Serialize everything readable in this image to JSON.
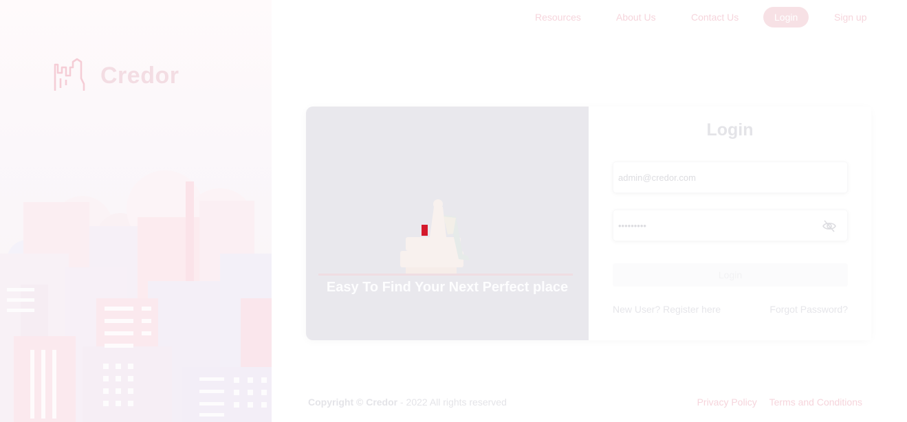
{
  "brand": {
    "name": "Credor"
  },
  "nav": {
    "items": [
      {
        "label": "Resources"
      },
      {
        "label": "About Us"
      },
      {
        "label": "Contact Us"
      },
      {
        "label": "Login"
      },
      {
        "label": "Sign up"
      }
    ]
  },
  "promo": {
    "tagline": "Easy To Find Your Next Perfect place"
  },
  "login": {
    "title": "Login",
    "email_value": "admin@credor.com",
    "password_value": "•••••••••",
    "submit_label": "Login",
    "register_link": "New User? Register here",
    "forgot_link": "Forgot Password?"
  },
  "footer": {
    "copyright_prefix": "Copyright ©",
    "copyright_brand": "Credor",
    "copyright_suffix": "- 2022 All rights reserved",
    "links": [
      {
        "label": "Privacy Policy"
      },
      {
        "label": "Terms and Conditions"
      }
    ]
  },
  "colors": {
    "accent": "#e8485f",
    "accent_faded": "#f6d5dc",
    "promo_bg": "#e9e8ed"
  },
  "icons": {
    "logo": "building-outline-icon",
    "password_toggle": "eye-slash-icon"
  }
}
